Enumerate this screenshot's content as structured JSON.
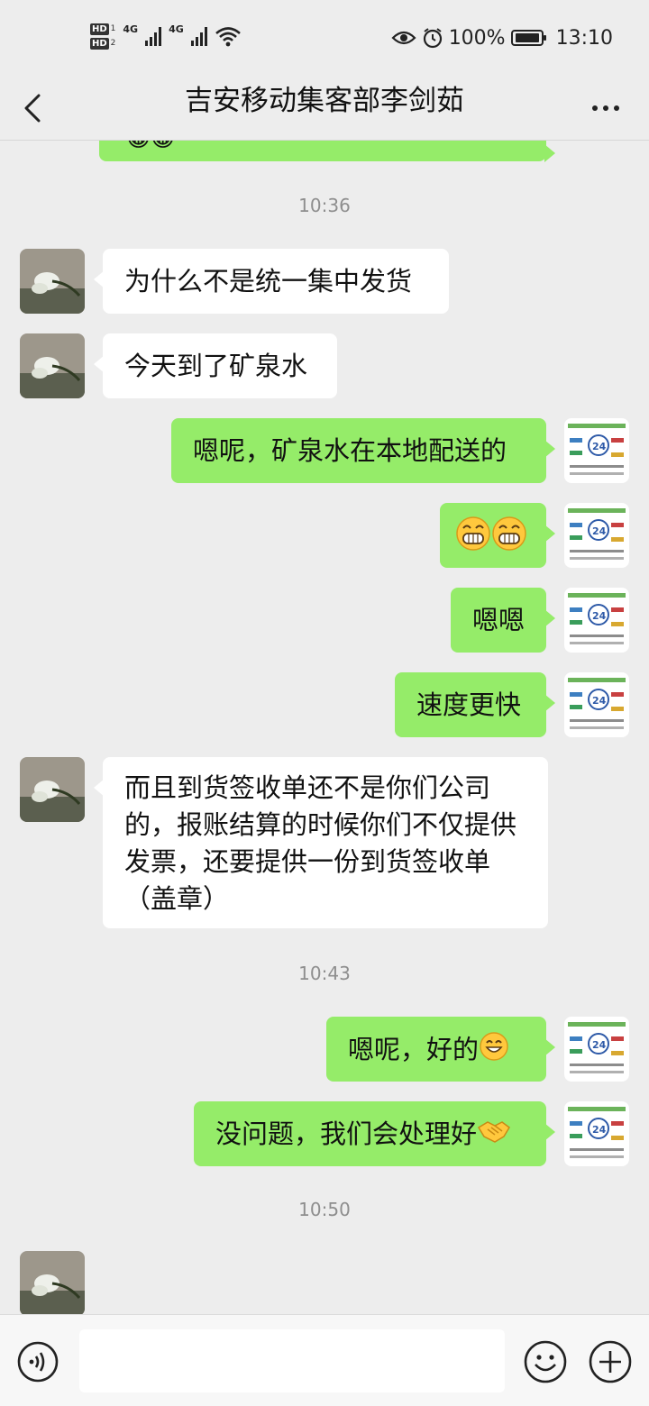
{
  "status_bar": {
    "hd1": "HD",
    "hd1_sub": "1",
    "hd2": "HD",
    "hd2_sub": "2",
    "network1": "4G",
    "network2": "4G",
    "battery": "100%",
    "time": "13:10"
  },
  "header": {
    "title": "吉安移动集客部李剑茹"
  },
  "chat": {
    "timestamps": [
      "10:36",
      "10:43",
      "10:50"
    ],
    "messages": [
      {
        "side": "in",
        "text": "为什么不是统一集中发货"
      },
      {
        "side": "in",
        "text": "今天到了矿泉水"
      },
      {
        "side": "out",
        "text": "嗯呢，矿泉水在本地配送的"
      },
      {
        "side": "out",
        "text": "",
        "emoji": "grin-emoji x2"
      },
      {
        "side": "out",
        "text": "嗯嗯"
      },
      {
        "side": "out",
        "text": "速度更快"
      },
      {
        "side": "in",
        "text": "而且到货签收单还不是你们公司的，报账结算的时候你们不仅提供发票，还要提供一份到货签收单（盖章）"
      },
      {
        "side": "out",
        "text": "嗯呢，好的",
        "emoji": "smile-emoji"
      },
      {
        "side": "out",
        "text": "没问题，我们会处理好",
        "emoji": "handshake-emoji"
      }
    ]
  },
  "input_bar": {
    "value": ""
  },
  "colors": {
    "background": "#ededed",
    "outgoing_bubble": "#95ec69",
    "incoming_bubble": "#ffffff",
    "timestamp": "#8e8e8e"
  }
}
